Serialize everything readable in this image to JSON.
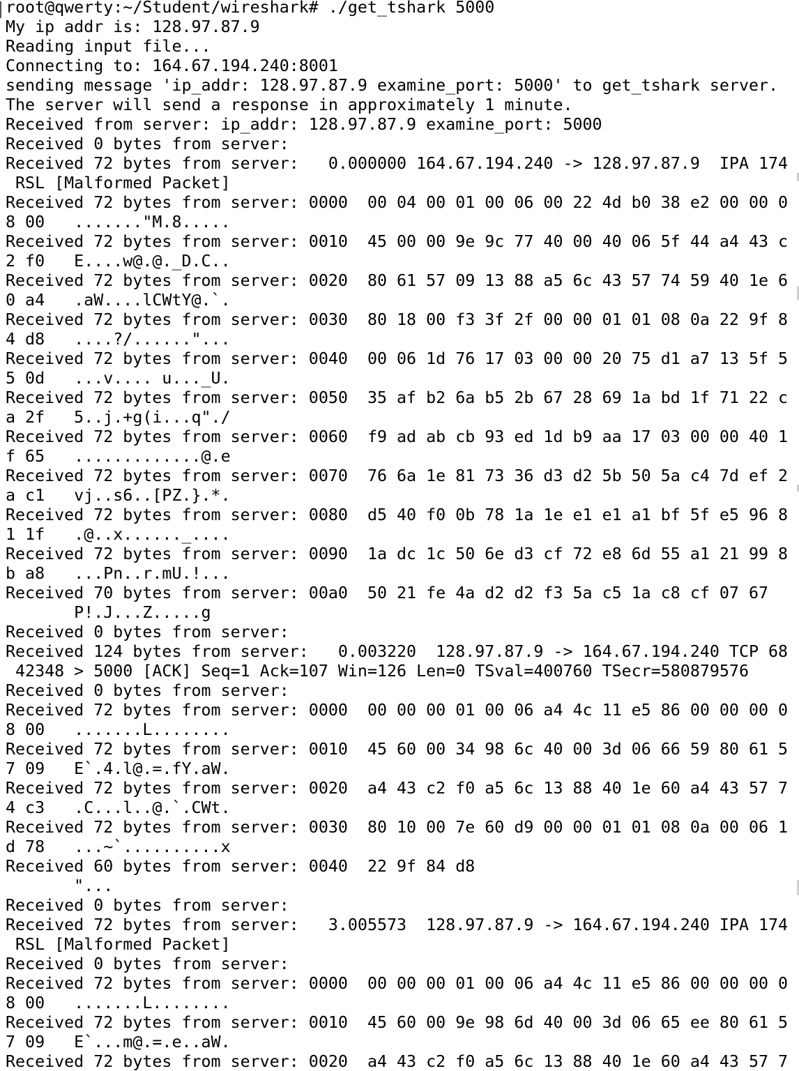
{
  "terminal": {
    "lines": [
      "root@qwerty:~/Student/wireshark# ./get_tshark 5000",
      "My ip addr is: 128.97.87.9",
      "Reading input file...",
      "Connecting to: 164.67.194.240:8001",
      "sending message 'ip_addr: 128.97.87.9 examine_port: 5000' to get_tshark server.",
      "The server will send a response in approximately 1 minute.",
      "Received from server: ip_addr: 128.97.87.9 examine_port: 5000",
      "Received 0 bytes from server:",
      "Received 72 bytes from server:   0.000000 164.67.194.240 -> 128.97.87.9  IPA 174",
      " RSL [Malformed Packet]",
      "Received 72 bytes from server: 0000  00 04 00 01 00 06 00 22 4d b0 38 e2 00 00 0",
      "8 00   .......\"M.8.....",
      "Received 72 bytes from server: 0010  45 00 00 9e 9c 77 40 00 40 06 5f 44 a4 43 c",
      "2 f0   E....w@.@._D.C..",
      "Received 72 bytes from server: 0020  80 61 57 09 13 88 a5 6c 43 57 74 59 40 1e 6",
      "0 a4   .aW....lCWtY@.`.",
      "Received 72 bytes from server: 0030  80 18 00 f3 3f 2f 00 00 01 01 08 0a 22 9f 8",
      "4 d8   ....?/......\"...",
      "Received 72 bytes from server: 0040  00 06 1d 76 17 03 00 00 20 75 d1 a7 13 5f 5",
      "5 0d   ...v.... u..._U.",
      "Received 72 bytes from server: 0050  35 af b2 6a b5 2b 67 28 69 1a bd 1f 71 22 c",
      "a 2f   5..j.+g(i...q\"./",
      "Received 72 bytes from server: 0060  f9 ad ab cb 93 ed 1d b9 aa 17 03 00 00 40 1",
      "f 65   .............@.e",
      "Received 72 bytes from server: 0070  76 6a 1e 81 73 36 d3 d2 5b 50 5a c4 7d ef 2",
      "a c1   vj..s6..[PZ.}.*.",
      "Received 72 bytes from server: 0080  d5 40 f0 0b 78 1a 1e e1 e1 a1 bf 5f e5 96 8",
      "1 1f   .@..x......_....",
      "Received 72 bytes from server: 0090  1a dc 1c 50 6e d3 cf 72 e8 6d 55 a1 21 99 8",
      "b a8   ...Pn..r.mU.!...",
      "Received 70 bytes from server: 00a0  50 21 fe 4a d2 d2 f3 5a c5 1a c8 cf 07 67",
      "       P!.J...Z.....g",
      "Received 0 bytes from server:",
      "Received 124 bytes from server:   0.003220  128.97.87.9 -> 164.67.194.240 TCP 68",
      " 42348 > 5000 [ACK] Seq=1 Ack=107 Win=126 Len=0 TSval=400760 TSecr=580879576",
      "Received 0 bytes from server:",
      "Received 72 bytes from server: 0000  00 00 00 01 00 06 a4 4c 11 e5 86 00 00 00 0",
      "8 00   .......L........",
      "Received 72 bytes from server: 0010  45 60 00 34 98 6c 40 00 3d 06 66 59 80 61 5",
      "7 09   E`.4.l@.=.fY.aW.",
      "Received 72 bytes from server: 0020  a4 43 c2 f0 a5 6c 13 88 40 1e 60 a4 43 57 7",
      "4 c3   .C...l..@.`.CWt.",
      "Received 72 bytes from server: 0030  80 10 00 7e 60 d9 00 00 01 01 08 0a 00 06 1",
      "d 78   ...~`..........x",
      "Received 60 bytes from server: 0040  22 9f 84 d8",
      "       \"...",
      "Received 0 bytes from server:",
      "Received 72 bytes from server:   3.005573  128.97.87.9 -> 164.67.194.240 IPA 174",
      " RSL [Malformed Packet]",
      "Received 0 bytes from server:",
      "Received 72 bytes from server: 0000  00 00 00 01 00 06 a4 4c 11 e5 86 00 00 00 0",
      "8 00   .......L........",
      "Received 72 bytes from server: 0010  45 60 00 9e 98 6d 40 00 3d 06 65 ee 80 61 5",
      "7 09   E`...m@.=.e..aW.",
      "Received 72 bytes from server: 0020  a4 43 c2 f0 a5 6c 13 88 40 1e 60 a4 43 57 7"
    ]
  }
}
